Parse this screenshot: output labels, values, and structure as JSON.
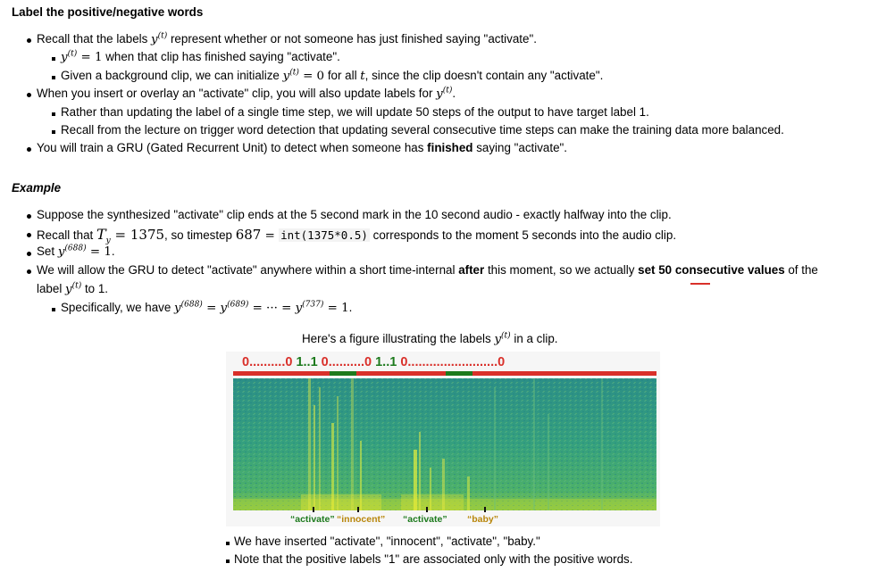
{
  "section_title": "Label the positive/negative words",
  "intro": {
    "b1": [
      "Recall that the labels ",
      " represent whether or not someone has just finished saying \"activate\"."
    ],
    "b1a": [
      "y",
      "(t)",
      " = 1",
      " when that clip has finished saying \"activate\"."
    ],
    "b1b": [
      "Given a background clip, we can initialize ",
      " = 0",
      " for all ",
      "t",
      ", since the clip doesn't contain any \"activate\"."
    ],
    "b2": [
      "When you insert or overlay an \"activate\" clip, you will also update labels for ",
      "."
    ],
    "b2a": "Rather than updating the label of a single time step, we will update 50 steps of the output to have target label 1.",
    "b2b": "Recall from the lecture on trigger word detection that updating several consecutive time steps can make the training data more balanced.",
    "b3": [
      "You will train a GRU (Gated Recurrent Unit) to detect when someone has ",
      "finished",
      " saying \"activate\"."
    ]
  },
  "example_title": "Example",
  "example": {
    "e1": "Suppose the synthesized \"activate\" clip ends at the 5 second mark in the 10 second audio - exactly halfway into the clip.",
    "e2": [
      "Recall that ",
      "T",
      "y",
      " = 1375",
      ", so timestep ",
      "687",
      " = ",
      "int(1375*0.5)",
      " corresponds to the moment 5 seconds into the audio clip."
    ],
    "e3": [
      "Set ",
      "(688)",
      " = 1",
      "."
    ],
    "e4": [
      "We will allow the GRU to detect \"activate\" anywhere within a short time-internal ",
      "after",
      " this moment, so we actually ",
      "set 50 consecutive values",
      " of the"
    ],
    "e4b": [
      "label ",
      " to 1."
    ],
    "e4a": [
      "Specifically, we have ",
      "(688)",
      " = ",
      "(689)",
      " = ··· = ",
      "(737)",
      " = 1",
      "."
    ]
  },
  "math": {
    "y": "y",
    "t_sup": "(t)"
  },
  "figure": {
    "caption": [
      "Here's a figure illustrating the labels ",
      " in a clip."
    ],
    "label_segments": [
      {
        "text": "0..........0",
        "color": "#d9302a",
        "bar": "#d9302a"
      },
      {
        "text": " 1..1 ",
        "color": "#1d7a1d",
        "bar": "#1d7a1d"
      },
      {
        "text": "0..........0",
        "color": "#d9302a",
        "bar": "#d9302a"
      },
      {
        "text": " 1..1 ",
        "color": "#1d7a1d",
        "bar": "#1d7a1d"
      },
      {
        "text": "0.........................0",
        "color": "#d9302a",
        "bar": "#d9302a"
      }
    ],
    "word_labels": [
      "“activate”",
      "“innocent”",
      "“activate”",
      "“baby”"
    ],
    "word_colors": [
      "#1d7a1d",
      "#b8860b",
      "#1d7a1d",
      "#b8860b"
    ]
  },
  "notes": [
    "We have inserted \"activate\", \"innocent\", \"activate\", \"baby.\"",
    "Note that the positive labels \"1\" are associated only with the positive words."
  ],
  "colors": {
    "red": "#d9302a",
    "green": "#1d7a1d",
    "spectro_base": "#3aa37c",
    "underline": "#d9302a"
  }
}
